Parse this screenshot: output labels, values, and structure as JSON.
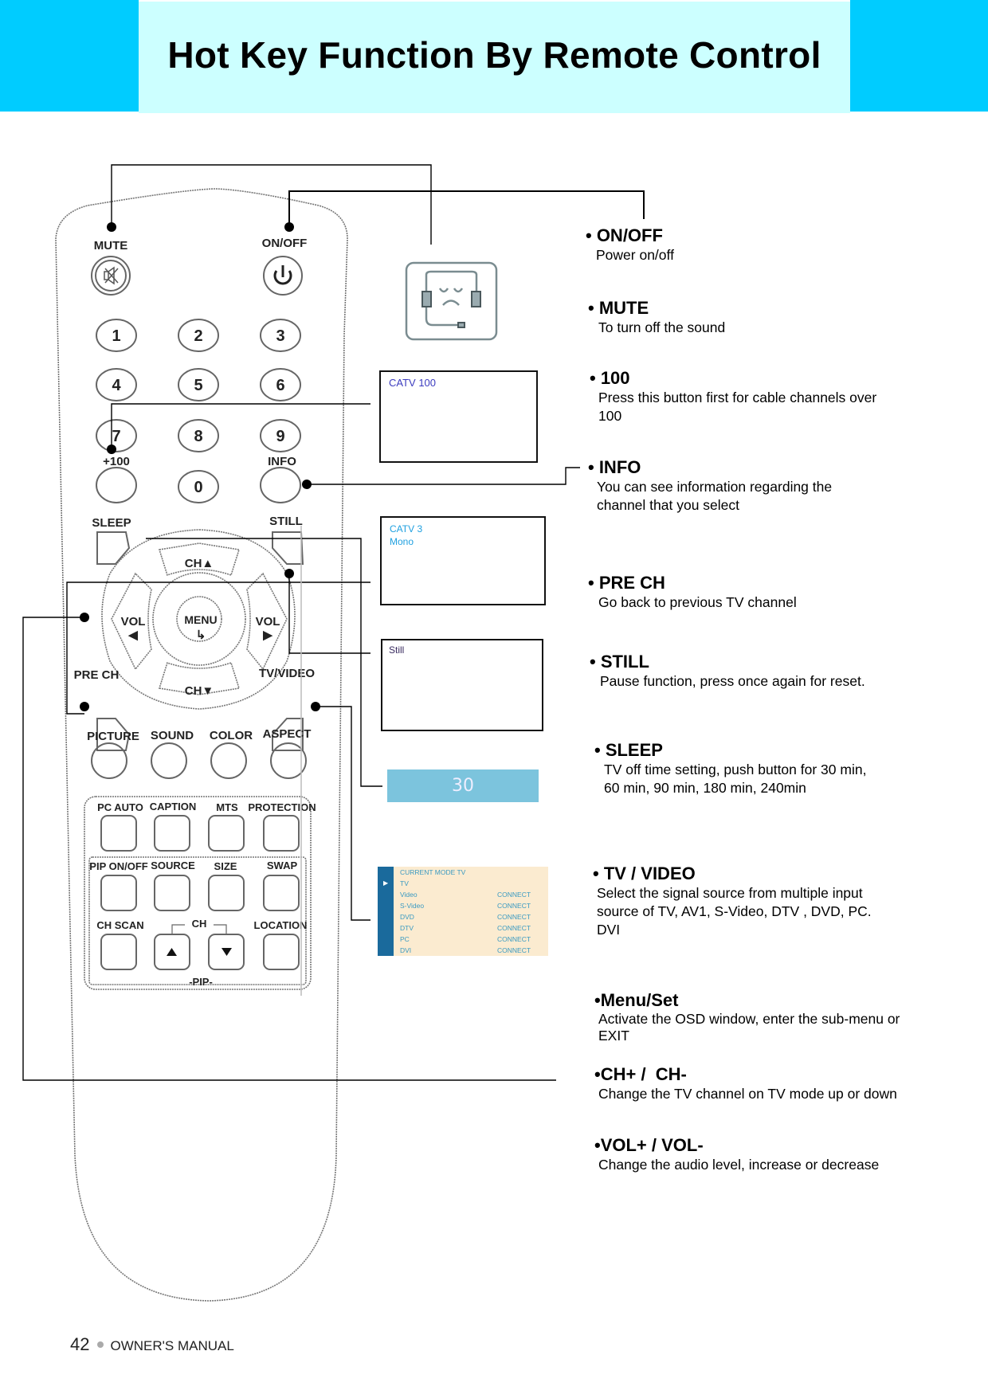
{
  "header": {
    "title": "Hot Key Function By Remote Control"
  },
  "remote": {
    "top_buttons": {
      "mute": "MUTE",
      "power": "ON/OFF"
    },
    "number_keys": [
      "1",
      "2",
      "3",
      "4",
      "5",
      "6",
      "7",
      "8",
      "9",
      "0"
    ],
    "plus100": "+100",
    "info": "INFO",
    "sleep": "SLEEP",
    "still": "STILL",
    "ch_up": "CH▲",
    "ch_down": "CH▼",
    "vol_left": "VOL",
    "vol_right": "VOL",
    "menu": "MENU",
    "pre_ch": "PRE CH",
    "tv_video": "TV/VIDEO",
    "row_labels": [
      "PICTURE",
      "SOUND",
      "COLOR",
      "ASPECT"
    ],
    "grid_row1": [
      "PC AUTO",
      "CAPTION",
      "MTS",
      "PROTECTION"
    ],
    "grid_row2": [
      "PIP ON/OFF",
      "SOURCE",
      "SIZE",
      "SWAP"
    ],
    "grid_row3": [
      "CH SCAN",
      "CH",
      "LOCATION"
    ],
    "pip_label": "-PIP-"
  },
  "osd": {
    "catv100": "CATV  100",
    "info_line1": "CATV 3",
    "info_line2": "Mono",
    "still": "Still",
    "sleep_value": "30",
    "source_menu": {
      "current_mode": "CURRENT MODE   TV",
      "items": [
        {
          "name": "TV",
          "status": ""
        },
        {
          "name": "Video",
          "status": "CONNECT"
        },
        {
          "name": "S-Video",
          "status": "CONNECT"
        },
        {
          "name": "DVD",
          "status": "CONNECT"
        },
        {
          "name": "DTV",
          "status": "CONNECT"
        },
        {
          "name": "PC",
          "status": "CONNECT"
        },
        {
          "name": "DVI",
          "status": "CONNECT"
        }
      ]
    }
  },
  "descriptions": [
    {
      "title": "• ON/OFF",
      "body": "Power on/off"
    },
    {
      "title": "• MUTE",
      "body": "To turn off the sound"
    },
    {
      "title": "• 100",
      "body": "Press this button first for cable channels over 100"
    },
    {
      "title": "• INFO",
      "body": "You can see information regarding the channel that you select"
    },
    {
      "title": "• PRE CH",
      "body": "Go back to previous TV channel"
    },
    {
      "title": "• STILL",
      "body": "Pause function, press once again for reset."
    },
    {
      "title": "• SLEEP",
      "body": "TV off time setting, push button for 30 min, 60 min, 90 min, 180 min, 240min"
    },
    {
      "title": "• TV / VIDEO",
      "body": "Select the signal source from multiple input source of TV, AV1, S-Video, DTV , DVD, PC. DVI"
    },
    {
      "title": "•Menu/Set",
      "body": "Activate the OSD window, enter the sub-menu or EXIT"
    },
    {
      "title": "•CH+ /  CH-",
      "body": "Change the TV channel on TV mode up or down"
    },
    {
      "title": "•VOL+ / VOL-",
      "body": "Change the audio level, increase or decrease"
    }
  ],
  "footer": {
    "page": "42",
    "label": "OWNER'S MANUAL"
  }
}
